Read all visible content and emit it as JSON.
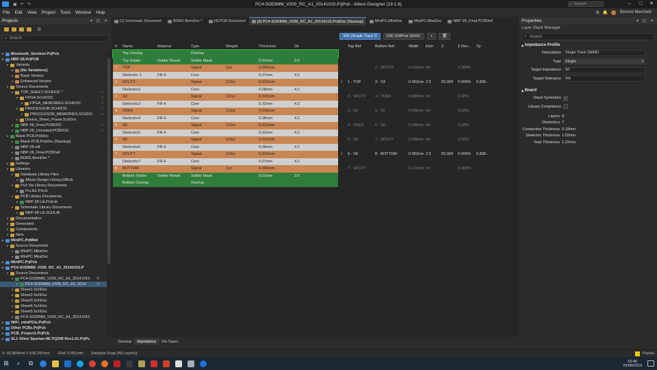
{
  "window": {
    "title": "PC4-SODIMM_V200_RC_A1_20141015.PrjPcb - Altium Designer (19.1.6)",
    "search_placeholder": "Search"
  },
  "menu": [
    "File",
    "Edit",
    "View",
    "Project",
    "Tools",
    "Window",
    "Help"
  ],
  "user": {
    "name": "Simone Marchetti"
  },
  "projects_panel": {
    "title": "Projects",
    "search_placeholder": "Search",
    "tree": [
      {
        "label": "Bluetooth_Sentinel.PrjPcb",
        "level": 0,
        "bold": true,
        "color": "#4a8fd8"
      },
      {
        "label": "NBP-28.PrjPCB",
        "level": 0,
        "bold": true,
        "color": "#4a8fd8"
      },
      {
        "label": "Variants",
        "level": 1,
        "color": "#c9a040"
      },
      {
        "label": "[No Variations]",
        "level": 2,
        "bold": true,
        "color": "#c98552"
      },
      {
        "label": "Basic Version",
        "level": 2,
        "color": "#c98552"
      },
      {
        "label": "Enhanced Version",
        "level": 2,
        "color": "#c98552"
      },
      {
        "label": "Source Documents",
        "level": 1,
        "color": "#c9a040"
      },
      {
        "label": "TOP_SHEET.SCHDOC *",
        "level": 2,
        "color": "#c9a040",
        "st": "✓"
      },
      {
        "label": "FPGA.SCHDOC",
        "level": 3,
        "color": "#c9a040",
        "st": "✓"
      },
      {
        "label": "FPGA_MEMORIES.SCHDOC",
        "level": 4,
        "color": "#c9a040",
        "st": "✓"
      },
      {
        "label": "PROCESSOR.SCHDOC",
        "level": 3,
        "color": "#c9a040",
        "st": "✓"
      },
      {
        "label": "PROCESSOR_MEMORIES.SCHDO",
        "level": 4,
        "color": "#c9a040",
        "st": "✓"
      },
      {
        "label": "Device_Sheet_Power.SchDoc",
        "level": 3,
        "color": "#c9a040"
      },
      {
        "label": "NBP-28_Final.PCBDOC",
        "level": 2,
        "color": "#3a8e4a",
        "st": "✓"
      },
      {
        "label": "NBP-28_Unrouted.PCBDOC",
        "level": 2,
        "color": "#3a8e4a",
        "st": "✓"
      },
      {
        "label": "Blank PCB.PcbDoc",
        "level": 1,
        "color": "#3a8e4a"
      },
      {
        "label": "Blank PCB.PcbDoc [Stackup]",
        "level": 2,
        "color": "#3a8e4a"
      },
      {
        "label": "NBP-28.xdf",
        "level": 2,
        "color": "#888888"
      },
      {
        "label": "NBP-28_Final.PCBDwf",
        "level": 2,
        "color": "#888888"
      },
      {
        "label": "BOM1.BomDoc *",
        "level": 2,
        "color": "#888888"
      },
      {
        "label": "Settings",
        "level": 1,
        "color": "#c9a040"
      },
      {
        "label": "Libraries",
        "level": 1,
        "color": "#c9a040"
      },
      {
        "label": "Database Library Files",
        "level": 2,
        "color": "#c9a040"
      },
      {
        "label": "Altium Design Library.DBLib",
        "level": 3,
        "color": "#888888"
      },
      {
        "label": "Pcd Via Library Documents",
        "level": 2,
        "color": "#c9a040"
      },
      {
        "label": "PcLib1.PvLib",
        "level": 3,
        "color": "#888888"
      },
      {
        "label": "PCB Library Documents",
        "level": 2,
        "color": "#c9a040"
      },
      {
        "label": "NBP-28 Lib.PcbLib",
        "level": 3,
        "color": "#3a8e4a"
      },
      {
        "label": "Schematic Library Documents",
        "level": 2,
        "color": "#c9a040"
      },
      {
        "label": "NBP-28 Lib.SCHLIB",
        "level": 3,
        "color": "#c9a040"
      },
      {
        "label": "Documentation",
        "level": 1,
        "color": "#c9a040"
      },
      {
        "label": "Generated",
        "level": 1,
        "color": "#c9a040"
      },
      {
        "label": "Components",
        "level": 1,
        "color": "#c9a040"
      },
      {
        "label": "Nets",
        "level": 1,
        "color": "#c9a040"
      },
      {
        "label": "MiniPC.PrjMbd",
        "level": 0,
        "bold": true,
        "color": "#4a8fd8"
      },
      {
        "label": "Source Documents",
        "level": 1,
        "color": "#c9a040"
      },
      {
        "label": "MiniPC.MbsDoc",
        "level": 2,
        "color": "#888888"
      },
      {
        "label": "MiniPC.MbaDoc",
        "level": 2,
        "color": "#888888"
      },
      {
        "label": "MiniPC.PrjPcb",
        "level": 0,
        "bold": true,
        "color": "#4a8fd8"
      },
      {
        "label": "PC4-SODIMM_V200_RC_A1_20141015.P",
        "level": 0,
        "bold": true,
        "color": "#4a8fd8"
      },
      {
        "label": "Source Documents",
        "level": 1,
        "color": "#c9a040"
      },
      {
        "label": "PC4-SODIMM_V200_RC_A1_20141015",
        "level": 2,
        "color": "#3a8e4a",
        "st2": "D"
      },
      {
        "label": "PC4-SODIMM_V200_RC_A1_2014",
        "level": 3,
        "color": "#3a8e4a",
        "sel": true,
        "st2": "D"
      },
      {
        "label": "Sheet1.SchDoc",
        "level": 2,
        "color": "#c9a040"
      },
      {
        "label": "Sheet2.SchDoc",
        "level": 2,
        "color": "#c9a040"
      },
      {
        "label": "Sheet3.SchDoc",
        "level": 2,
        "color": "#c9a040"
      },
      {
        "label": "Sheet4.SchDoc",
        "level": 2,
        "color": "#c9a040"
      },
      {
        "label": "Sheet5.SchDoc",
        "level": 2,
        "color": "#c9a040"
      },
      {
        "label": "PC4-SODIMM_V200_RC_A1_20141015",
        "level": 2,
        "color": "#888888"
      },
      {
        "label": "WiFi_miniPCIe.PrjPcb",
        "level": 0,
        "bold": true,
        "color": "#4a8fd8"
      },
      {
        "label": "Other PCBs.PrjPcb",
        "level": 0,
        "bold": true,
        "color": "#4a8fd8"
      },
      {
        "label": "PCB_Project1.PrjPcb",
        "level": 0,
        "bold": true,
        "color": "#4a8fd8"
      },
      {
        "label": "SL1 Xilinx Spartan-IIE PQ208 Rev1.01.PrjPc",
        "level": 0,
        "bold": true,
        "color": "#4a8fd8"
      }
    ]
  },
  "doc_tabs": [
    {
      "label": "[1] Schematic Document",
      "active": false
    },
    {
      "label": "BOM1.BomDoc *",
      "active": false
    },
    {
      "label": "[4] PCB Document",
      "active": false
    },
    {
      "label": "[3] PC4-SODIMM_V200_RC_A1_20141015.PcbDoc [Stackup]",
      "active": true
    },
    {
      "label": "MiniPC.MbsDoc",
      "active": false
    },
    {
      "label": "MiniPC.MbaDoc",
      "active": false
    },
    {
      "label": "NBP-28_Final.PCBDwf",
      "active": false
    }
  ],
  "editor": {
    "buttons": {
      "single_track": "S50 (Single Track D",
      "diff_pair": "D90 (DiffPair DEMC",
      "add": "+",
      "delete": "🗑"
    },
    "left_headers": [
      "#",
      "Name",
      "Material",
      "Type",
      "Weight",
      "Thickness",
      "Dk"
    ],
    "right_headers": [
      "",
      "Top Ref",
      "Bottom Ref",
      "Width",
      "Etch",
      "Z",
      "Z Dev...",
      "Tp"
    ],
    "rows": [
      {
        "n": "",
        "name": "Top Overlay",
        "material": "",
        "type": "Overlay",
        "weight": "",
        "thickness": "",
        "dk": "",
        "kind": "overlay",
        "r": [
          "",
          "",
          "",
          "",
          "",
          "",
          "",
          ""
        ]
      },
      {
        "n": "",
        "name": "Top Solder",
        "material": "Solder Resist",
        "type": "Solder Mask",
        "weight": "",
        "thickness": "0.01mm",
        "dk": "3.5",
        "kind": "mask",
        "r": [
          "",
          "",
          "",
          "",
          "",
          "",
          "",
          ""
        ]
      },
      {
        "n": "1",
        "name": "TOP",
        "material": "",
        "type": "Signal",
        "weight": "1oz",
        "thickness": "0.045mm",
        "dk": "",
        "kind": "signal",
        "r": [
          "",
          "",
          "2 - SPLIT2",
          "0.102mm",
          "Inf",
          "",
          "0.000%",
          ""
        ]
      },
      {
        "n": "",
        "name": "Dielectric 1",
        "material": "FR-4",
        "type": "Core",
        "weight": "",
        "thickness": "0.07mm",
        "dk": "4.2",
        "kind": "diel",
        "r": [
          "",
          "",
          "",
          "",
          "",
          "",
          "",
          ""
        ]
      },
      {
        "n": "2",
        "name": "SPLIT2",
        "material": "",
        "type": "Signal",
        "weight": "1/2oz",
        "thickness": "0.015mm",
        "dk": "",
        "kind": "signal",
        "r": [
          "✓",
          "1 - TOP",
          "3 - S3",
          "0.052mm",
          "2.5",
          "50.004",
          "0.009%",
          "6.836..."
        ],
        "hl": true
      },
      {
        "n": "",
        "name": "Dielectric2",
        "material": "",
        "type": "Core",
        "weight": "",
        "thickness": "0.08mm",
        "dk": "4.2",
        "kind": "diel",
        "r": [
          "",
          "",
          "",
          "",
          "",
          "",
          "",
          ""
        ]
      },
      {
        "n": "3",
        "name": "S3",
        "material": "",
        "type": "Signal",
        "weight": "1/2oz",
        "thickness": "0.015mm",
        "dk": "",
        "kind": "signal",
        "r": [
          "",
          "2 - SPLIT2",
          "4 - VDD4",
          "0.086mm",
          "Inf",
          "",
          "0.02%",
          ""
        ]
      },
      {
        "n": "",
        "name": "Dielectric3",
        "material": "FR-4",
        "type": "Core",
        "weight": "",
        "thickness": "0.32mm",
        "dk": "4.2",
        "kind": "diel",
        "r": [
          "",
          "",
          "",
          "",
          "",
          "",
          "",
          ""
        ]
      },
      {
        "n": "4",
        "name": "VDD4",
        "material": "",
        "type": "Signal",
        "weight": "1/2oz",
        "thickness": "0.015mm",
        "dk": "",
        "kind": "signal",
        "r": [
          "",
          "3 - S3",
          "5 - S5",
          "0.086mm",
          "Inf",
          "",
          "0.02%",
          ""
        ]
      },
      {
        "n": "",
        "name": "Dielectric4",
        "material": "FR-4",
        "type": "Core",
        "weight": "",
        "thickness": "0.08mm",
        "dk": "4.2",
        "kind": "diel",
        "r": [
          "",
          "",
          "",
          "",
          "",
          "",
          "",
          ""
        ]
      },
      {
        "n": "5",
        "name": "S5",
        "material": "",
        "type": "Signal",
        "weight": "1/2oz",
        "thickness": "0.015mm",
        "dk": "",
        "kind": "signal",
        "r": [
          "",
          "4 - VDD4",
          "6 - S6",
          "0.086mm",
          "Inf",
          "",
          "0.02%",
          ""
        ]
      },
      {
        "n": "",
        "name": "Dielectric5",
        "material": "FR-4",
        "type": "Core",
        "weight": "",
        "thickness": "0.32mm",
        "dk": "4.2",
        "kind": "diel",
        "r": [
          "",
          "",
          "",
          "",
          "",
          "",
          "",
          ""
        ]
      },
      {
        "n": "6",
        "name": "S6",
        "material": "",
        "type": "Signal",
        "weight": "1/2oz",
        "thickness": "0.015mm",
        "dk": "",
        "kind": "signal",
        "r": [
          "",
          "5 - S5",
          "7 - SPLIT7",
          "0.086mm",
          "Inf",
          "",
          "0.02%",
          ""
        ]
      },
      {
        "n": "",
        "name": "Dielectric6",
        "material": "FR-4",
        "type": "Core",
        "weight": "",
        "thickness": "0.08mm",
        "dk": "4.2",
        "kind": "diel",
        "r": [
          "",
          "",
          "",
          "",
          "",
          "",
          "",
          ""
        ]
      },
      {
        "n": "7",
        "name": "SPLIT7",
        "material": "",
        "type": "Signal",
        "weight": "1/2oz",
        "thickness": "0.015mm",
        "dk": "",
        "kind": "signal",
        "r": [
          "✓",
          "6 - S6",
          "8 - BOTTOM",
          "0.052mm",
          "2.5",
          "50.004",
          "0.009%",
          "6.836..."
        ],
        "hl": true
      },
      {
        "n": "",
        "name": "Dielectric7",
        "material": "FR-4",
        "type": "Core",
        "weight": "",
        "thickness": "0.07mm",
        "dk": "4.2",
        "kind": "diel",
        "r": [
          "",
          "",
          "",
          "",
          "",
          "",
          "",
          ""
        ]
      },
      {
        "n": "8",
        "name": "BOTTOM",
        "material": "",
        "type": "Signal",
        "weight": "1oz",
        "thickness": "0.045mm",
        "dk": "",
        "kind": "signal",
        "r": [
          "",
          "7 - SPLIT7",
          "",
          "0.102mm",
          "Inf",
          "",
          "0.000%",
          ""
        ]
      },
      {
        "n": "",
        "name": "Bottom Solder",
        "material": "Solder Resist",
        "type": "Solder Mask",
        "weight": "",
        "thickness": "0.01mm",
        "dk": "3.5",
        "kind": "mask",
        "r": [
          "",
          "",
          "",
          "",
          "",
          "",
          "",
          ""
        ]
      },
      {
        "n": "",
        "name": "Bottom Overlay",
        "material": "",
        "type": "Overlay",
        "weight": "",
        "thickness": "",
        "dk": "",
        "kind": "overlay",
        "r": [
          "",
          "",
          "",
          "",
          "",
          "",
          "",
          ""
        ]
      }
    ],
    "bottom_tabs": [
      {
        "label": "Stackup",
        "active": false
      },
      {
        "label": "Impedance",
        "active": true
      },
      {
        "label": "Via Types",
        "active": false
      }
    ]
  },
  "properties": {
    "title": "Properties",
    "subtitle": "Layer Stack Manager",
    "search_placeholder": "Search",
    "impedance_section": "Impedance Profile",
    "description_label": "Description",
    "description_value": "Single Track DEMO",
    "type_label": "Type",
    "type_value": "Single",
    "target_label": "Target impedance",
    "target_value": "50",
    "tolerance_label": "Target Tolerance",
    "tolerance_value": "5%",
    "board_section": "Board",
    "stack_symmetry_label": "Stack Symmetry",
    "stack_symmetry": true,
    "library_compliance_label": "Library Compliance",
    "library_compliance": false,
    "stats": [
      {
        "label": "Layers",
        "value": "8"
      },
      {
        "label": "Dielectrics",
        "value": "7"
      },
      {
        "label": "Conductive Thickness",
        "value": "0.18mm"
      },
      {
        "label": "Dielectric Thickness",
        "value": "1.02mm"
      },
      {
        "label": "Total Thickness",
        "value": "1.22mm"
      }
    ]
  },
  "statusbar": {
    "coords": "X:-56.864mm Y:106.341mm",
    "grid": "Grid: 0.001mm",
    "snap": "[Hotspot Snap (All Layers)]",
    "panels": "Panels"
  },
  "taskbar": {
    "time": "10:40",
    "date": "29/08/2019"
  },
  "colors": {
    "signal": "#c98552",
    "overlay": "#2f7d3a",
    "dielectric": "#cfcfcf",
    "accent": "#3d6fa8"
  }
}
